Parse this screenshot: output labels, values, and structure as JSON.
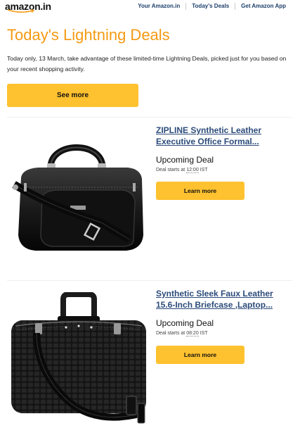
{
  "header": {
    "logo_text": "amazon.in",
    "nav": [
      "Your Amazon.in",
      "Today's Deals",
      "Get Amazon App"
    ]
  },
  "main": {
    "title": "Today's Lightning Deals",
    "intro": "Today only, 13 March, take advantage of these limited-time Lightning Deals, picked just for you based on your recent shopping activity.",
    "see_more_label": "See more"
  },
  "deals": [
    {
      "title_line1": "ZIPLINE Synthetic Leather",
      "title_line2": "Executive Office Formal...",
      "status": "Upcoming Deal",
      "starts_prefix": "Deal starts at",
      "starts_time": "12:00",
      "starts_zone": "IST",
      "button_label": "Learn more"
    },
    {
      "title_line1": "Synthetic Sleek Faux Leather",
      "title_line2": "15.6-Inch Briefcase ,Laptop...",
      "status": "Upcoming Deal",
      "starts_prefix": "Deal starts at",
      "starts_time": "08:20",
      "starts_zone": "IST",
      "button_label": "Learn more"
    }
  ],
  "colors": {
    "title_orange": "#f49a13",
    "button_yellow": "#fec12f",
    "link_blue": "#2c4b7a",
    "smile_orange": "#f49a13"
  }
}
